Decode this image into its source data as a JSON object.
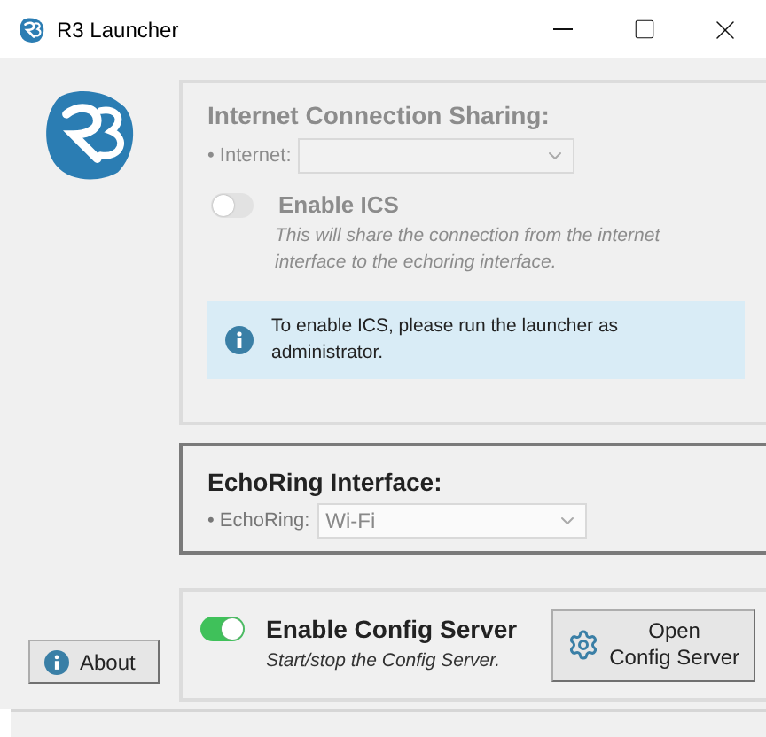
{
  "window": {
    "title": "R3 Launcher"
  },
  "ics": {
    "title": "Internet Connection Sharing:",
    "disabled": true,
    "internet_label": "• Internet:",
    "toggle_label": "Enable ICS",
    "on": false,
    "description": "This will share the connection from the internet interface to the echoring interface.",
    "info": "To enable ICS, please run the launcher as administrator."
  },
  "echoring": {
    "title": "EchoRing Interface:",
    "label": "• EchoRing:",
    "value": "Wi-Fi"
  },
  "config_server": {
    "label": "Enable Config Server",
    "on": true,
    "description": "Start/stop the Config Server.",
    "button": "Open\nConfig Server"
  },
  "about_button": "About"
}
